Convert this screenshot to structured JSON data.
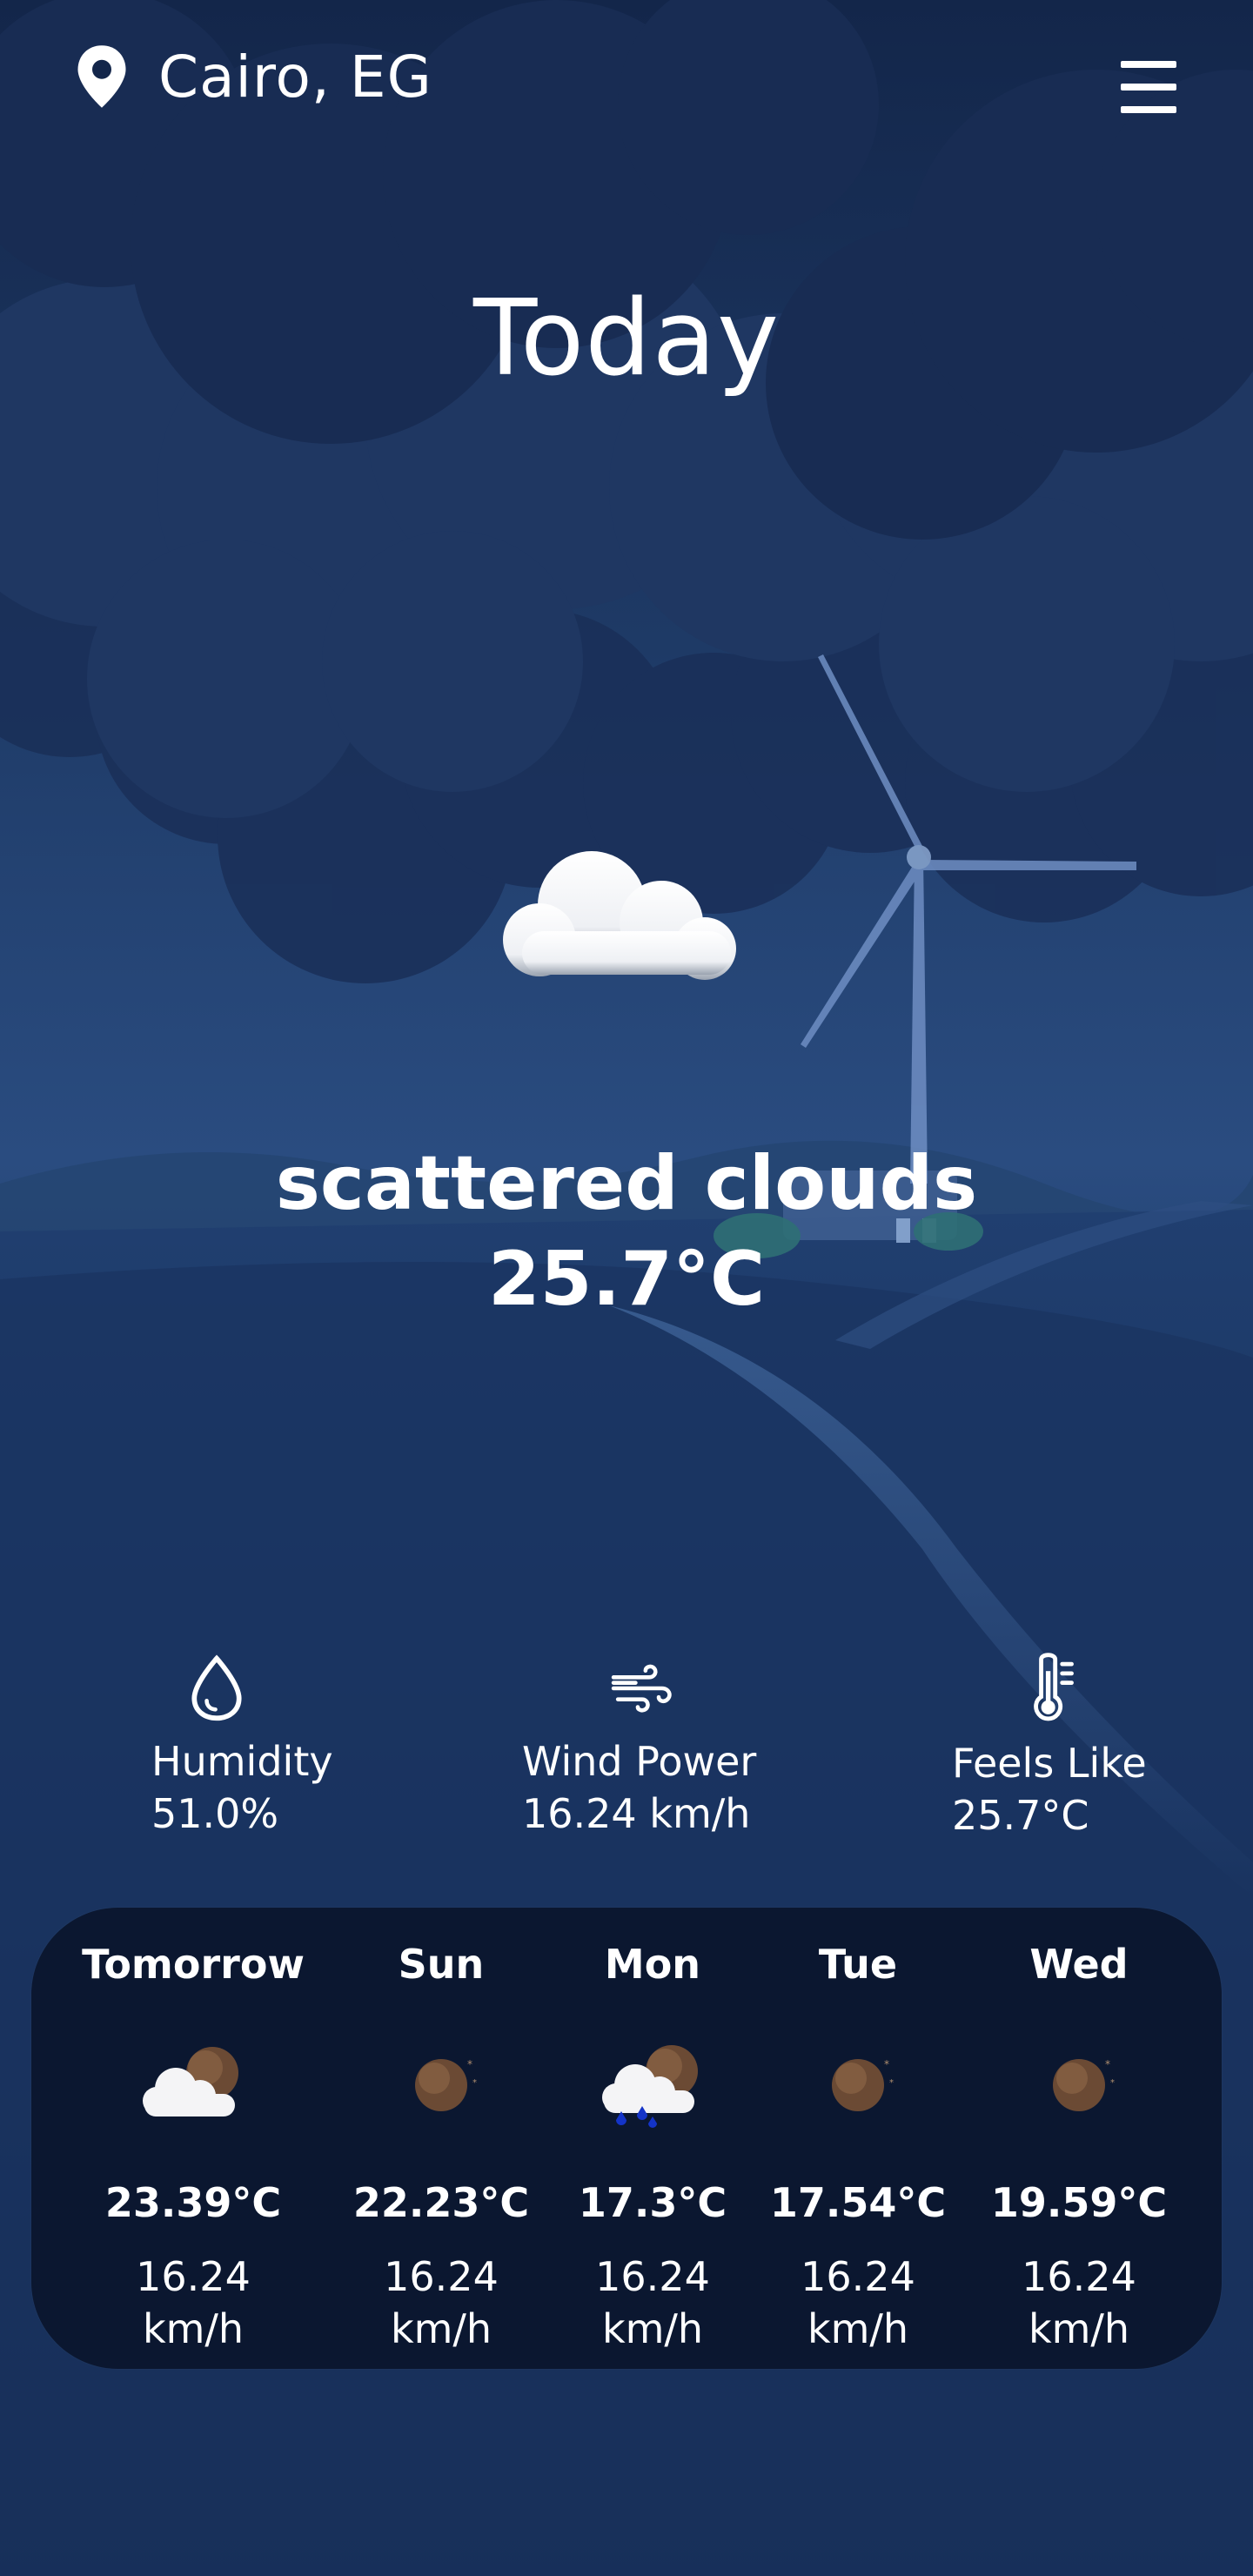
{
  "header": {
    "location": "Cairo, EG",
    "location_icon": "map-pin-icon",
    "menu_icon": "hamburger-menu-icon"
  },
  "current": {
    "title": "Today",
    "icon": "cloud-icon",
    "condition": "scattered clouds",
    "temperature": "25.7°C"
  },
  "stats": [
    {
      "icon": "water-drop-icon",
      "label": "Humidity",
      "value": "51.0%"
    },
    {
      "icon": "wind-icon",
      "label": "Wind Power",
      "value": "16.24 km/h"
    },
    {
      "icon": "thermometer-icon",
      "label": "Feels Like",
      "value": "25.7°C"
    }
  ],
  "forecast": [
    {
      "day": "Tomorrow",
      "icon": "moon-cloud-icon",
      "temp": "23.39°C",
      "wind_value": "16.24",
      "wind_unit": "km/h"
    },
    {
      "day": "Sun",
      "icon": "moon-icon",
      "temp": "22.23°C",
      "wind_value": "16.24",
      "wind_unit": "km/h"
    },
    {
      "day": "Mon",
      "icon": "moon-rain-cloud-icon",
      "temp": "17.3°C",
      "wind_value": "16.24",
      "wind_unit": "km/h"
    },
    {
      "day": "Tue",
      "icon": "moon-icon",
      "temp": "17.54°C",
      "wind_value": "16.24",
      "wind_unit": "km/h"
    },
    {
      "day": "Wed",
      "icon": "moon-icon",
      "temp": "19.59°C",
      "wind_value": "16.24",
      "wind_unit": "km/h"
    }
  ],
  "colors": {
    "background": "#0d1b38",
    "sky": "#1f3a68",
    "cloud_dark": "#1c3058",
    "panel": "#0b1730",
    "text": "#ffffff"
  }
}
